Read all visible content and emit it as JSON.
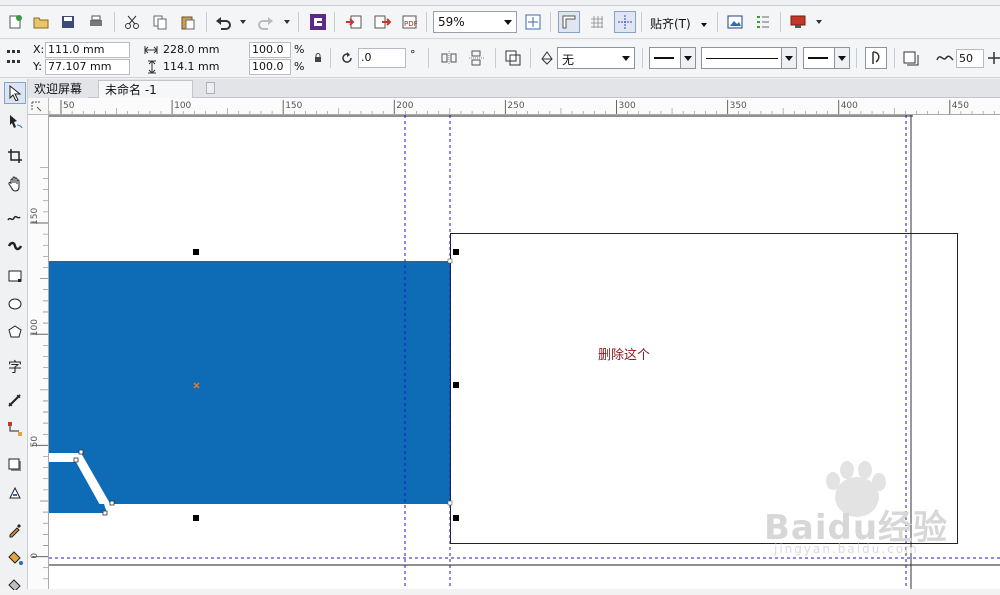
{
  "toolbar": {
    "zoom_value": "59%",
    "snap_label": "贴齐(T)"
  },
  "property_bar": {
    "x_label": "X:",
    "x_value": "111.0 mm",
    "y_label": "Y:",
    "y_value": "77.107 mm",
    "width_value": "228.0 mm",
    "height_value": "114.1 mm",
    "scale_x": "100.0",
    "scale_y": "100.0",
    "percent_symbol": "%",
    "rotation_value": ".0",
    "degree_symbol": "°",
    "fill_value": "无",
    "outline_width": "50"
  },
  "doc_tabs": {
    "welcome": "欢迎屏幕",
    "untitled": "未命名 -1"
  },
  "rulers": {
    "h_ticks": [
      "50",
      "100",
      "150",
      "200",
      "250",
      "300",
      "350",
      "400",
      "450"
    ],
    "v_ticks": [
      "150",
      "100",
      "50",
      "0"
    ]
  },
  "canvas": {
    "annotation": "删除这个",
    "watermark": "Baidu经验",
    "watermark_sub": "jingyan.baidu.com",
    "colors": {
      "blue_shape": "#0e6cb6",
      "annotation_text": "#8b1a1a",
      "guide_line": "#1a1acc"
    }
  }
}
